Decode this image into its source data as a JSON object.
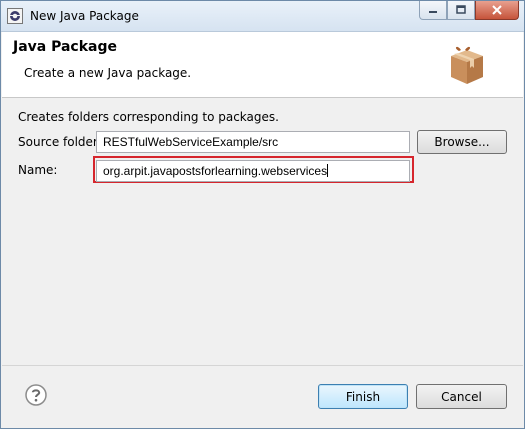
{
  "window": {
    "title": "New Java Package"
  },
  "titlebar_buttons": {
    "minimize": "minimize-icon",
    "maximize": "maximize-icon",
    "close": "close-icon"
  },
  "header": {
    "title": "Java Package",
    "description": "Create a new Java package."
  },
  "form": {
    "intro": "Creates folders corresponding to packages.",
    "source_folder_label": "Source folder:",
    "source_folder_value": "RESTfulWebServiceExample/src",
    "browse_label": "Browse...",
    "name_label": "Name:",
    "name_value": "org.arpit.javapostsforlearning.webservices"
  },
  "footer": {
    "help_icon": "help-icon",
    "finish_label": "Finish",
    "cancel_label": "Cancel"
  },
  "colors": {
    "highlight": "#d6262d",
    "default_button": "#3c7fb1"
  }
}
